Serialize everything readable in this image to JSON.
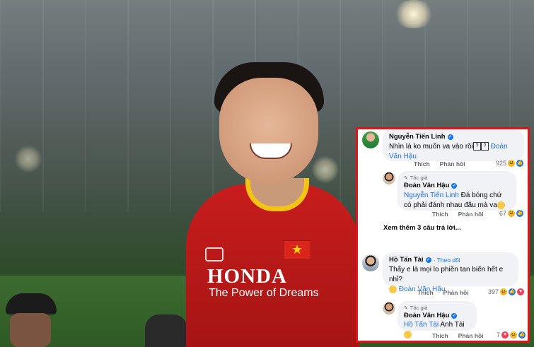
{
  "photo": {
    "shirt_sponsor": "HONDA",
    "shirt_tagline": "The Power of Dreams",
    "flag_star": "★"
  },
  "comments": [
    {
      "author": "Nguyễn Tiến Linh",
      "text": "Nhìn là ko muốn va vào rồi",
      "mention": "Đoàn Văn Hậu",
      "actions": [
        "Thích",
        "Phản hồi"
      ],
      "reaction_count": "925"
    },
    {
      "badge": "Tác giả",
      "author": "Đoàn Văn Hậu",
      "mention": "Nguyễn Tiến Linh",
      "text": "Đá bóng chứ có phải đánh nhau đâu mà va",
      "actions": [
        "Thích",
        "Phản hồi"
      ],
      "reaction_count": "67"
    },
    {
      "author": "Hồ Tấn Tài",
      "follow": "Theo dõi",
      "text": "Thấy e là mọi lo phiền tan biến hết e nhỉ?",
      "mention": "Đoàn Văn Hậu",
      "actions": [
        "Thích",
        "Phản hồi"
      ],
      "reaction_count": "397"
    },
    {
      "badge": "Tác giả",
      "author": "Đoàn Văn Hậu",
      "mention": "Hồ Tấn Tài",
      "text": "Anh Tài",
      "actions": [
        "Thích",
        "Phản hồi"
      ],
      "reaction_count": "7"
    }
  ],
  "more_replies": "Xem thêm 3 câu trả lời...",
  "colors": {
    "panel_border": "#e0141b",
    "mention": "#216fdb",
    "follow": "#1877f2"
  }
}
